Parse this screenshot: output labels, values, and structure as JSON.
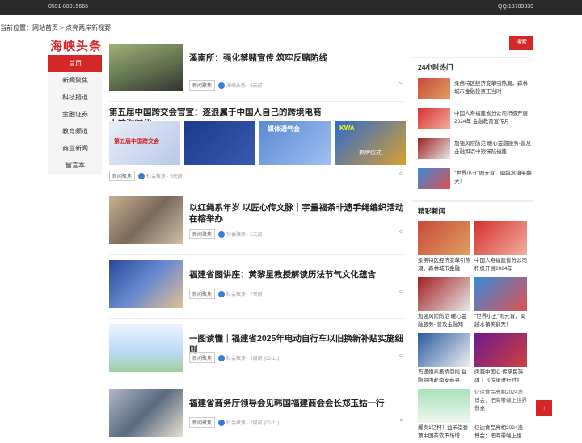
{
  "topbar": {
    "phone": "0591-88915666",
    "qq": "QQ:13789339"
  },
  "breadcrumb": {
    "prefix": "当前位置：",
    "home": "网站首页",
    "sep": " > ",
    "current": "点亮两岸新视野"
  },
  "logo": "海峡头条",
  "nav": [
    {
      "label": "首页",
      "active": true
    },
    {
      "label": "新闻聚焦"
    },
    {
      "label": "科技报道"
    },
    {
      "label": "金融证券"
    },
    {
      "label": "教育频道"
    },
    {
      "label": "商业新闻"
    },
    {
      "label": "留言本"
    }
  ],
  "articles": [
    {
      "title": "溪南所：强化禁赌宣传 筑牢反赌防线",
      "tag": "新闻聚焦",
      "author": "海峡头条",
      "time": "3天前"
    },
    {
      "title": "第五届中国跨交会官宣：逐浪属于中国人自己的跨境电商大航海时代",
      "tag": "新闻聚焦",
      "author": "社会聚焦",
      "time": "5天前"
    },
    {
      "title": "以红绳系年岁 以匠心传文脉｜宇量福茶非遗手绳编织活动在榕举办",
      "tag": "新闻聚焦",
      "author": "社会聚焦",
      "time": "5天前"
    },
    {
      "title": "福建省图讲座：黄黎星教授解读历法节气文化蕴含",
      "tag": "新闻聚焦",
      "author": "社会聚焦",
      "time": "7天前"
    },
    {
      "title": "一图读懂｜福建省2025年电动自行车以旧换新补贴实施细则",
      "tag": "新闻聚焦",
      "author": "社会聚焦",
      "time": "2周前 (02-11)"
    },
    {
      "title": "福建省商务厅领导会见韩国福建商会会长郑玉姑一行",
      "tag": "新闻聚焦",
      "author": "社会聚焦",
      "time": "2周前 (02-11)"
    }
  ],
  "art2_images": [
    "第五届中国跨交会",
    "媒体通气会",
    "KWA",
    "揭牌仪式"
  ],
  "search": {
    "button": "搜索"
  },
  "hot": {
    "title": "24小时热门",
    "items": [
      "柔佛特区经济变革引热潮，森林城市金融投资正当时",
      "中国人寿福建省分公司积极开展2024年 金融教育宣传月",
      "加强风险防范 暖心金融服务-普及金融知识中银保险福建",
      "\"世界小丑\"闹元宵，闽越水镇笑翻天！"
    ]
  },
  "featured": {
    "title": "精彩新闻",
    "items": [
      "柔佛特区经济变革引热潮，森林城市金融",
      "中国人寿福建省分公司积极开展2024年",
      "加强风险防范 暖心金融服务- 普及金融知",
      "\"世界小丑\"闹元宵，闽越水镇笑翻天！",
      "巧遇姐亲搭桥引线 台胞组团赴南安恭寻",
      "闽越中国心 传承民族魂｜《传承进行时》",
      "爆卖1亿杯！益禾堂登顶中国茶饮市场增",
      "亿达食品亮相2024渔博会：把海带端上世"
    ]
  },
  "featured_img_alt": "亿达食品亮相2024渔博会：把海带端上世界餐桌",
  "totop": "↑"
}
